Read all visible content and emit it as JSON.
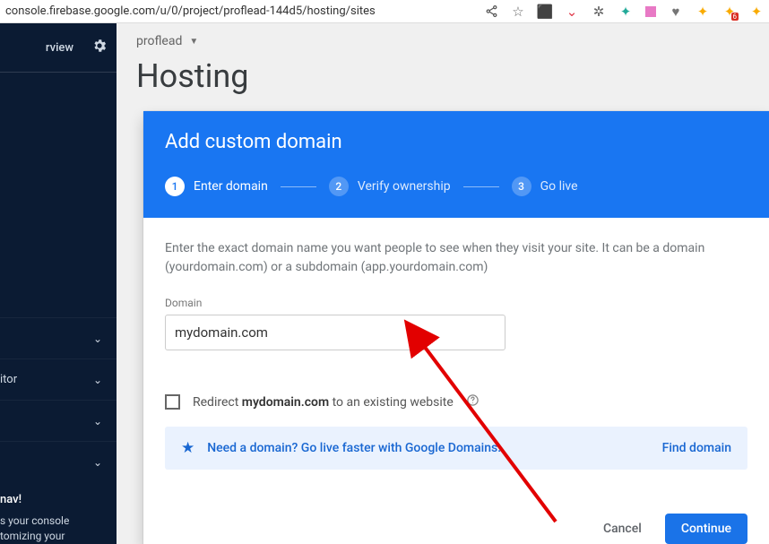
{
  "browser": {
    "url": "console.firebase.google.com/u/0/project/proflead-144d5/hosting/sites"
  },
  "sidebar": {
    "overview_tab": "rview",
    "items": [
      "",
      "itor",
      "",
      ""
    ],
    "footer_title": "nav!",
    "footer_blurb": "s your console tomizing your"
  },
  "breadcrumb": {
    "project": "proflead"
  },
  "page": {
    "title": "Hosting"
  },
  "modal": {
    "title": "Add custom domain",
    "steps": [
      {
        "num": "1",
        "label": "Enter domain"
      },
      {
        "num": "2",
        "label": "Verify ownership"
      },
      {
        "num": "3",
        "label": "Go live"
      }
    ],
    "helper": "Enter the exact domain name you want people to see when they visit your site. It can be a domain (yourdomain.com) or a subdomain (app.yourdomain.com)",
    "field_label": "Domain",
    "domain_value": "mydomain.com",
    "redirect_pre": "Redirect ",
    "redirect_domain": "mydomain.com",
    "redirect_post": " to an existing website",
    "promo_msg": "Need a domain? Go live faster with Google Domains.",
    "promo_action": "Find domain",
    "cancel": "Cancel",
    "continue": "Continue"
  }
}
